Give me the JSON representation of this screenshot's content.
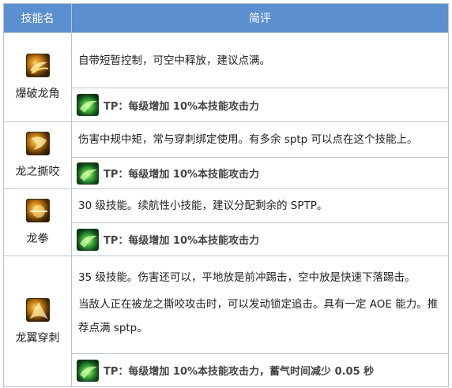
{
  "header": {
    "col_name": "技能名",
    "col_review": "简评"
  },
  "skills": [
    {
      "name": "爆破龙角",
      "desc": [
        "自带短暂控制，可空中释放，建议点满。"
      ],
      "tp_prefix": "TP：",
      "tp_text": "每级增加 10%本技能攻击力"
    },
    {
      "name": "龙之撕咬",
      "desc": [
        "伤害中规中矩，常与穿刺绑定使用。有多余 sptp 可以点在这个技能上。"
      ],
      "tp_prefix": "TP：",
      "tp_text": "每级增加 10%本技能攻击力"
    },
    {
      "name": "龙拳",
      "desc": [
        "30 级技能。续航性小技能，建议分配剩余的 SPTP。"
      ],
      "tp_prefix": "TP：",
      "tp_text": "每级增加 10%本技能攻击力"
    },
    {
      "name": "龙翼穿刺",
      "desc": [
        "35 级技能。伤害还可以，平地放是前冲踢击，空中放是快速下落踢击。",
        "当敌人正在被龙之撕咬攻击时，可以发动锁定追击。具有一定 AOE 能力。推荐点满 sptp。"
      ],
      "tp_prefix": "TP：",
      "tp_text": "每级增加 10%本技能攻击力，蓄气时间减少 0.05 秒"
    }
  ],
  "icons": {
    "skill_icon": "golden-dragon-skill-icon",
    "tp_icon": "green-tp-icon"
  },
  "colors": {
    "header_bg": "#5b8fcf",
    "border": "#b8c4d6"
  }
}
